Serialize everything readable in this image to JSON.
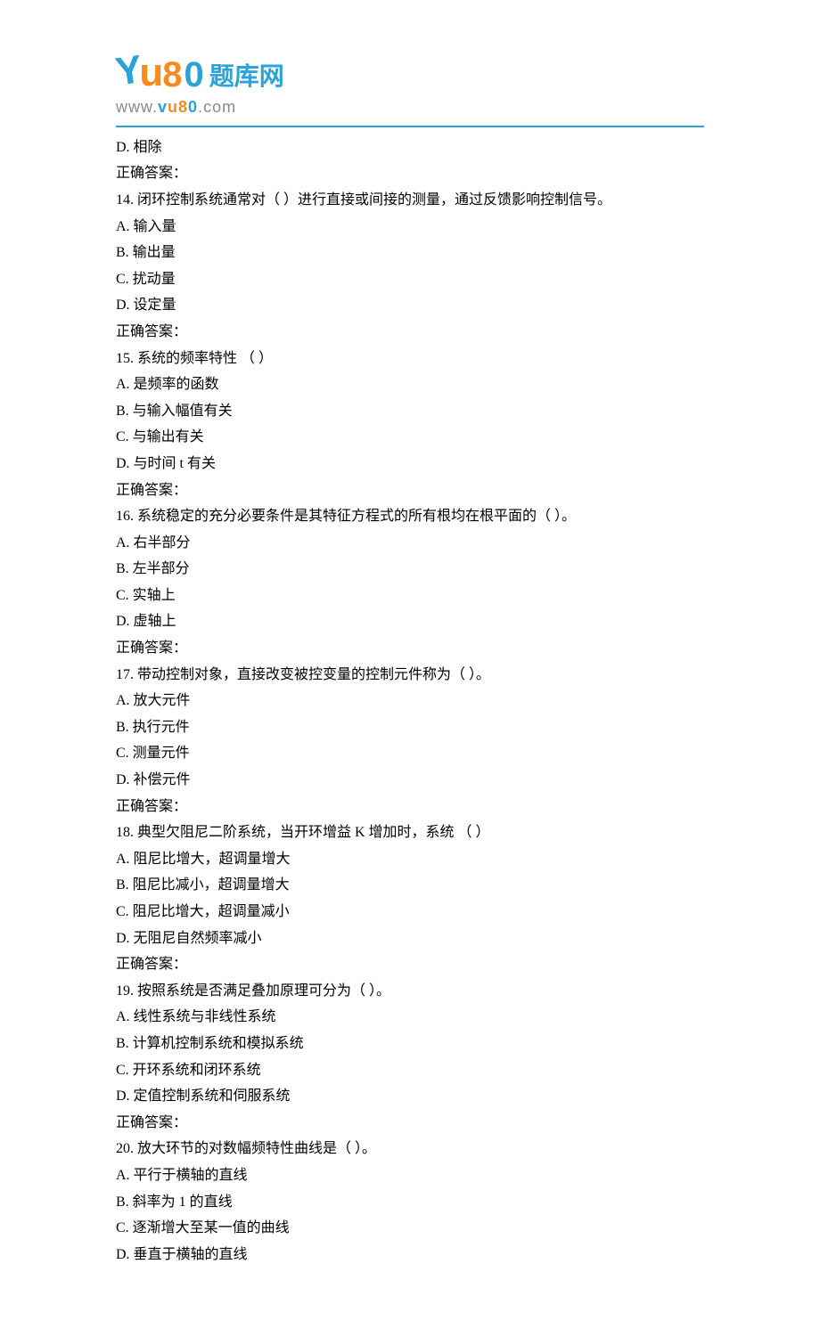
{
  "logo": {
    "brand_text": "题库网",
    "url_prefix": "www.",
    "url_v": "v",
    "url_u": "u",
    "url_8": "8",
    "url_0": "0",
    "url_suffix": ".com"
  },
  "pre_lines": [
    "D.  相除",
    "正确答案："
  ],
  "questions": [
    {
      "stem": "14.   闭环控制系统通常对（  ）进行直接或间接的测量，通过反馈影响控制信号。",
      "options": [
        "A.  输入量",
        "B.  输出量",
        "C.  扰动量",
        "D.  设定量"
      ],
      "answer_label": "正确答案："
    },
    {
      "stem": "15.   系统的频率特性 （  ）",
      "options": [
        "A. 是频率的函数",
        "B.  与输入幅值有关",
        "C.  与输出有关",
        "D.  与时间 t 有关"
      ],
      "answer_label": "正确答案："
    },
    {
      "stem": "16.   系统稳定的充分必要条件是其特征方程式的所有根均在根平面的（  ）。",
      "options": [
        "A.  右半部分",
        "B.  左半部分",
        "C.  实轴上",
        "D.  虚轴上"
      ],
      "answer_label": "正确答案："
    },
    {
      "stem": "17.   带动控制对象，直接改变被控变量的控制元件称为（  ）。",
      "options": [
        "A.  放大元件",
        "B.  执行元件",
        "C.  测量元件",
        "D.  补偿元件"
      ],
      "answer_label": "正确答案："
    },
    {
      "stem": "18.   典型欠阻尼二阶系统，当开环增益 K 增加时，系统 （  ）",
      "options": [
        "A.  阻尼比增大，超调量增大",
        "B.  阻尼比减小，超调量增大",
        "C.  阻尼比增大，超调量减小",
        "D.  无阻尼自然频率减小"
      ],
      "answer_label": "正确答案："
    },
    {
      "stem": "19.   按照系统是否满足叠加原理可分为（  ）。",
      "options": [
        "A.  线性系统与非线性系统",
        "B.  计算机控制系统和模拟系统",
        "C.  开环系统和闭环系统",
        "D.  定值控制系统和伺服系统"
      ],
      "answer_label": "正确答案："
    },
    {
      "stem": "20.   放大环节的对数幅频特性曲线是（  ）。",
      "options": [
        "A.  平行于横轴的直线",
        "B.  斜率为 1 的直线",
        "C.  逐渐增大至某一值的曲线",
        "D.  垂直于横轴的直线"
      ],
      "answer_label": ""
    }
  ]
}
